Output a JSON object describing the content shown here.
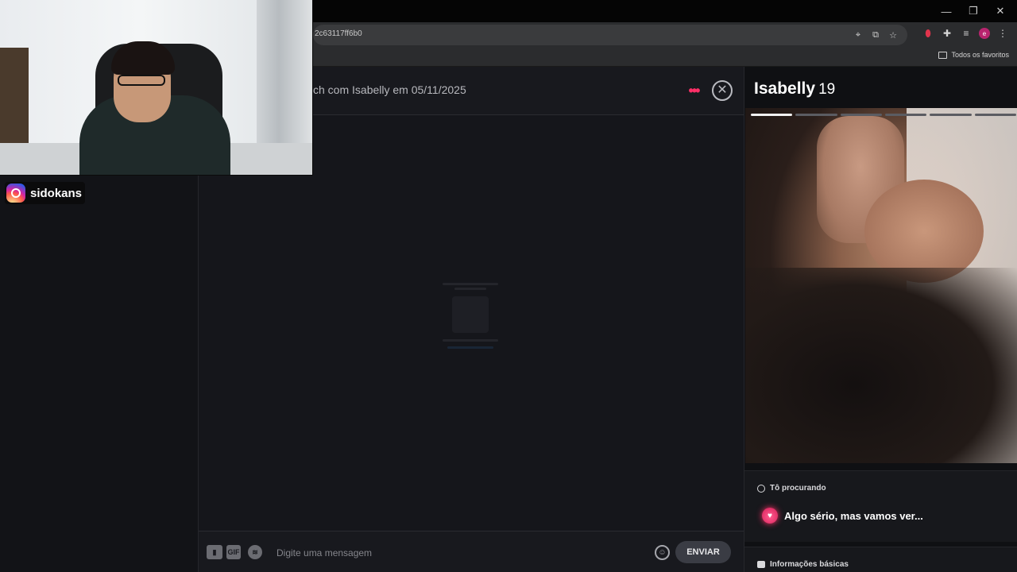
{
  "browser": {
    "url": "2c63117ff6b0",
    "avatar_letter": "e",
    "bookmark_folder": "Todos os favoritos",
    "window_controls": [
      "minimize-icon",
      "restore-icon",
      "close-icon"
    ]
  },
  "chat": {
    "title": "ch com Isabelly em 05/11/2025",
    "more_label": "•••",
    "close_label": "✕"
  },
  "composer": {
    "gif_label": "GIF",
    "placeholder": "Digite uma mensagem",
    "send_label": "ENVIAR"
  },
  "profile": {
    "name": "Isabelly",
    "age": "19",
    "photo_count": 6,
    "active_photo": 1,
    "looking_label": "Tô procurando",
    "looking_value": "Algo sério, mas vamos ver...",
    "basic_info_label": "Informações básicas"
  },
  "stream": {
    "instagram_handle": "sidokans"
  },
  "colors": {
    "accent": "#ff2f67",
    "background": "#15161b"
  }
}
